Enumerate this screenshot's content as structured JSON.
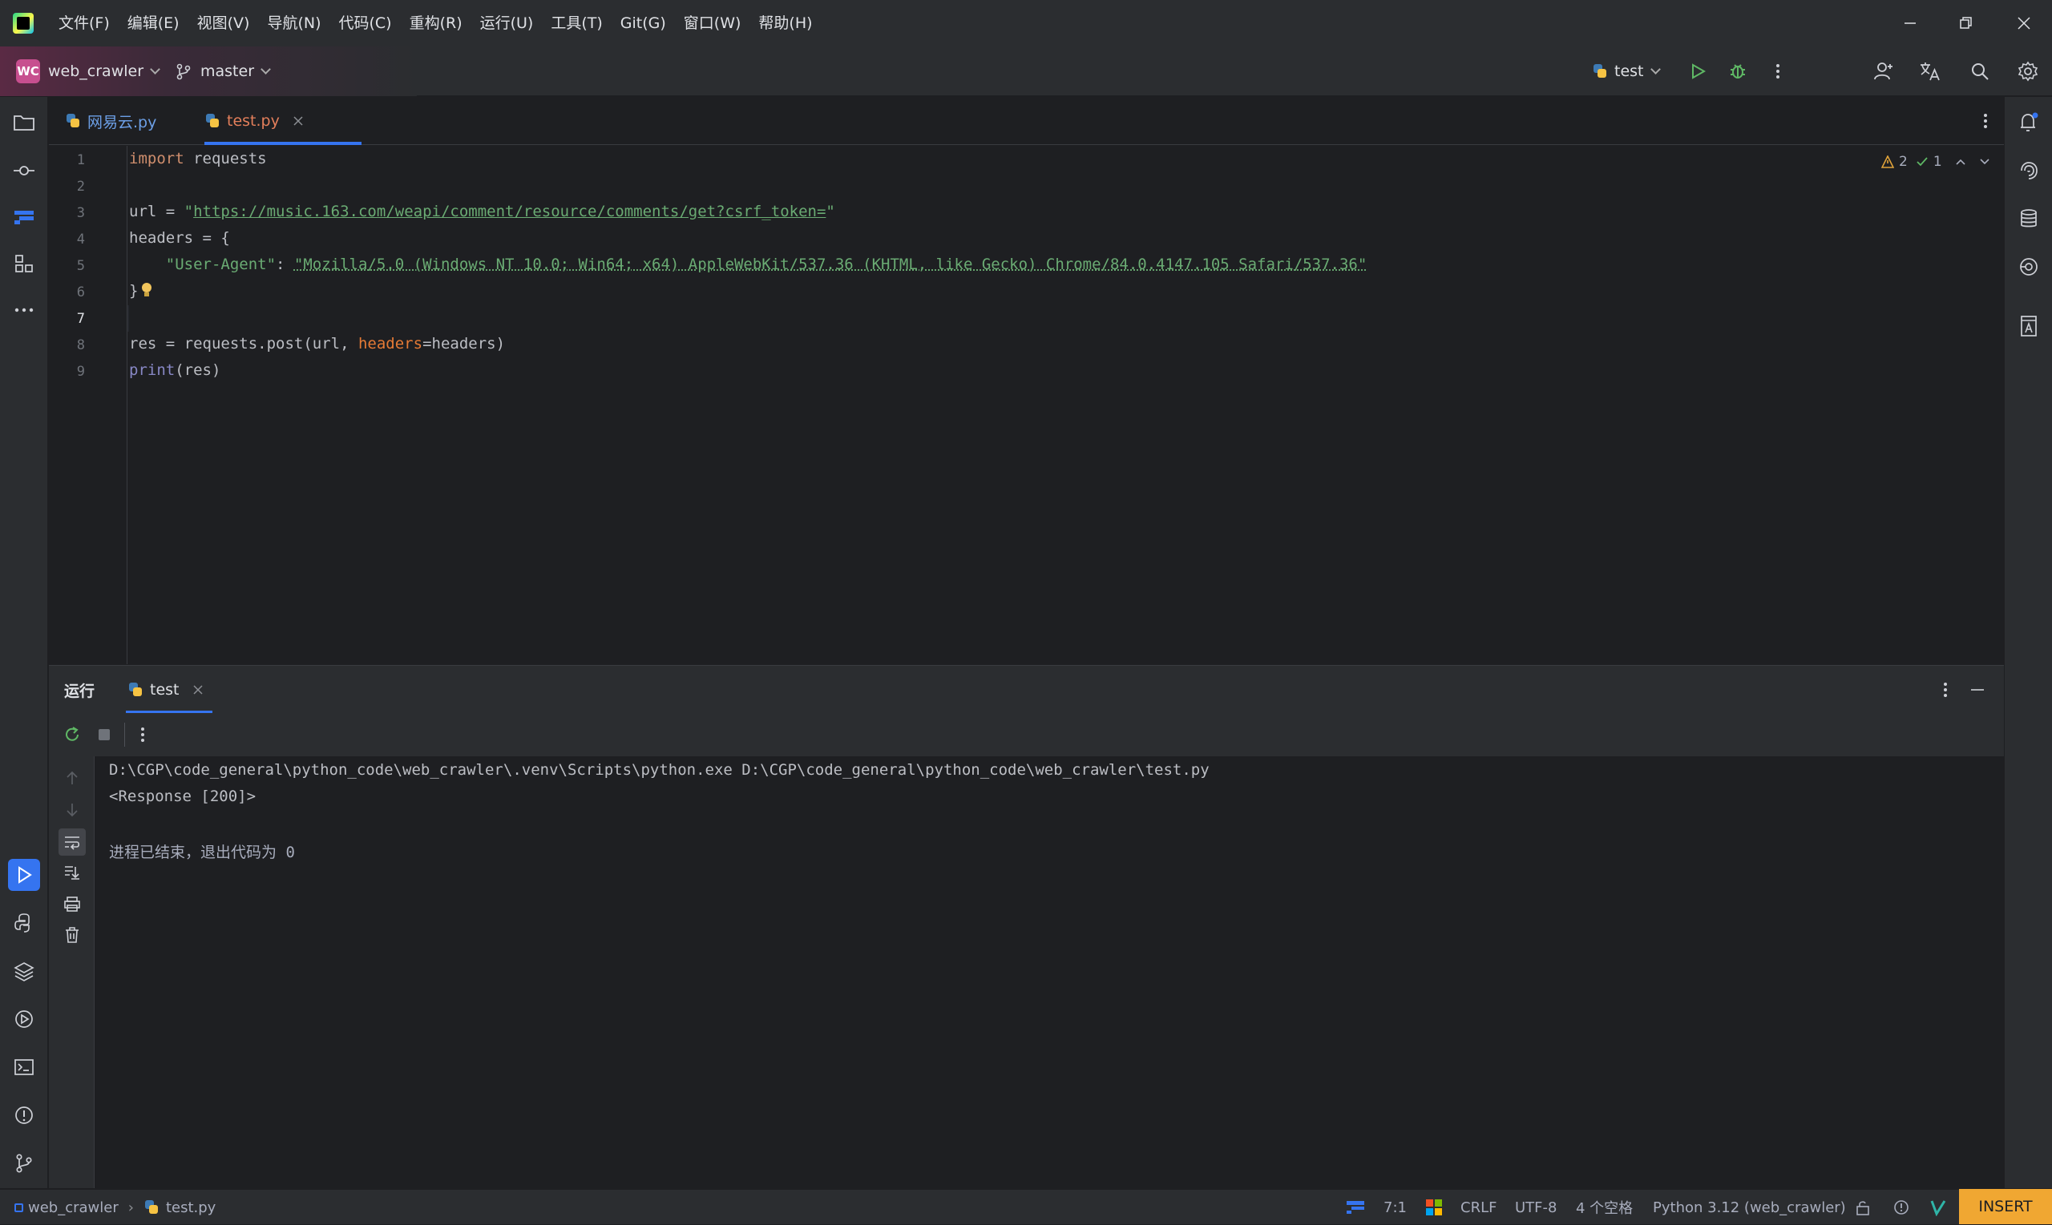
{
  "menu": [
    "文件(F)",
    "编辑(E)",
    "视图(V)",
    "导航(N)",
    "代码(C)",
    "重构(R)",
    "运行(U)",
    "工具(T)",
    "Git(G)",
    "窗口(W)",
    "帮助(H)"
  ],
  "toolbar": {
    "project_badge": "WC",
    "project_name": "web_crawler",
    "branch": "master",
    "run_config": "test"
  },
  "tabs": [
    {
      "label": "网易云.py",
      "active": false
    },
    {
      "label": "test.py",
      "active": true
    }
  ],
  "inspections": {
    "warnings": "2",
    "ok": "1"
  },
  "code": {
    "line_numbers": [
      "1",
      "2",
      "3",
      "4",
      "5",
      "6",
      "7",
      "8",
      "9"
    ],
    "l1_kw": "import",
    "l1_rest": " requests",
    "l3_pre": "url = ",
    "l3_q1": "\"",
    "l3_url": "https://music.163.com/weapi/comment/resource/comments/get?csrf_token=",
    "l3_q2": "\"",
    "l4": "headers = {",
    "l5_key": "    \"User-Agent\"",
    "l5_colon": ": ",
    "l5_val": "\"Mozilla/5.0 (Windows NT 10.0; Win64; x64) AppleWebKit/537.36 (KHTML, like Gecko) Chrome/84.0.4147.105 Safari/537.36\"",
    "l6": "}",
    "l8_pre": "res = requests.post(url, ",
    "l8_param": "headers",
    "l8_post": "=headers)",
    "l9_fn": "print",
    "l9_rest": "(res)"
  },
  "run_panel": {
    "title": "运行",
    "tab": "test",
    "output": [
      "D:\\CGP\\code_general\\python_code\\web_crawler\\.venv\\Scripts\\python.exe D:\\CGP\\code_general\\python_code\\web_crawler\\test.py",
      "<Response [200]>",
      "",
      "进程已结束，退出代码为 0"
    ]
  },
  "status": {
    "breadcrumb_project": "web_crawler",
    "breadcrumb_file": "test.py",
    "position": "7:1",
    "line_sep": "CRLF",
    "encoding": "UTF-8",
    "indent": "4 个空格",
    "interpreter": "Python 3.12 (web_crawler)",
    "mode": "INSERT"
  },
  "colors": {
    "accent": "#3574f0",
    "insert_badge": "#f0a732",
    "project_badge": "#c74f8f"
  }
}
